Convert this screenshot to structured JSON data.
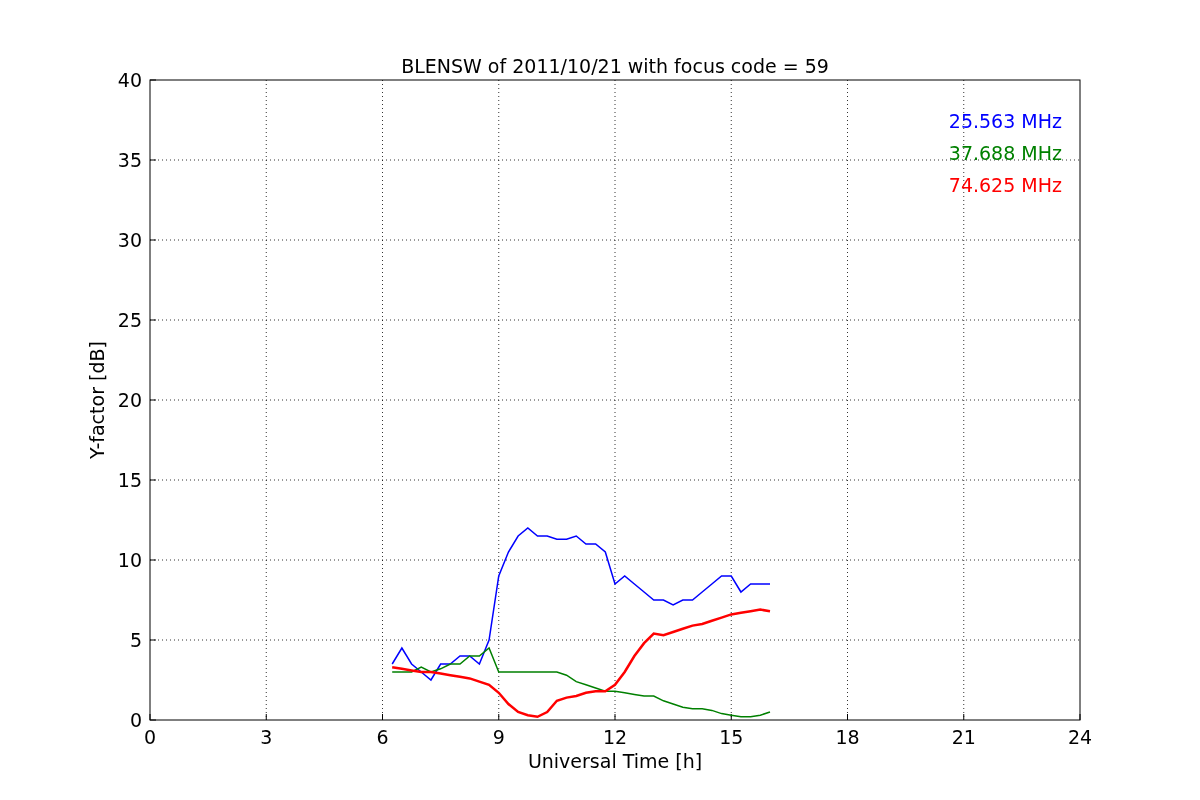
{
  "chart_data": {
    "type": "line",
    "title": "BLENSW of 2011/10/21 with focus code = 59",
    "xlabel": "Universal Time [h]",
    "ylabel": "Y-factor [dB]",
    "xlim": [
      0,
      24
    ],
    "ylim": [
      0,
      40
    ],
    "xticks": [
      0,
      3,
      6,
      9,
      12,
      15,
      18,
      21,
      24
    ],
    "yticks": [
      0,
      5,
      10,
      15,
      20,
      25,
      30,
      35,
      40
    ],
    "grid": true,
    "x": [
      6.25,
      6.5,
      6.75,
      7,
      7.25,
      7.5,
      7.75,
      8,
      8.25,
      8.5,
      8.75,
      9,
      9.25,
      9.5,
      9.75,
      10,
      10.25,
      10.5,
      10.75,
      11,
      11.25,
      11.5,
      11.75,
      12,
      12.25,
      12.5,
      12.75,
      13,
      13.25,
      13.5,
      13.75,
      14,
      14.25,
      14.5,
      14.75,
      15,
      15.25,
      15.5,
      15.75,
      16
    ],
    "series": [
      {
        "name": "25.563 MHz",
        "color": "#0000ff",
        "values": [
          3.5,
          4.5,
          3.5,
          3,
          2.5,
          3.5,
          3.5,
          4,
          4,
          3.5,
          5,
          9,
          10.5,
          11.5,
          12,
          11.5,
          11.5,
          11.3,
          11.3,
          11.5,
          11,
          11,
          10.5,
          8.5,
          9,
          8.5,
          8,
          7.5,
          7.5,
          7.2,
          7.5,
          7.5,
          8,
          8.5,
          9,
          9,
          8,
          8.5,
          8.5,
          8.5
        ]
      },
      {
        "name": "37.688 MHz",
        "color": "#008000",
        "values": [
          3,
          3,
          3,
          3.3,
          3,
          3.2,
          3.5,
          3.5,
          4,
          4,
          4.5,
          3,
          3,
          3,
          3,
          3,
          3,
          3,
          2.8,
          2.4,
          2.2,
          2,
          1.8,
          1.8,
          1.7,
          1.6,
          1.5,
          1.5,
          1.2,
          1,
          0.8,
          0.7,
          0.7,
          0.6,
          0.4,
          0.3,
          0.2,
          0.2,
          0.3,
          0.5
        ]
      },
      {
        "name": "74.625 MHz",
        "color": "#ff0000",
        "values": [
          3.3,
          3.2,
          3.1,
          3,
          3,
          2.9,
          2.8,
          2.7,
          2.6,
          2.4,
          2.2,
          1.7,
          1,
          0.5,
          0.3,
          0.2,
          0.5,
          1.2,
          1.4,
          1.5,
          1.7,
          1.8,
          1.8,
          2.2,
          3,
          4,
          4.8,
          5.4,
          5.3,
          5.5,
          5.7,
          5.9,
          6,
          6.2,
          6.4,
          6.6,
          6.7,
          6.8,
          6.9,
          6.8
        ]
      }
    ]
  }
}
